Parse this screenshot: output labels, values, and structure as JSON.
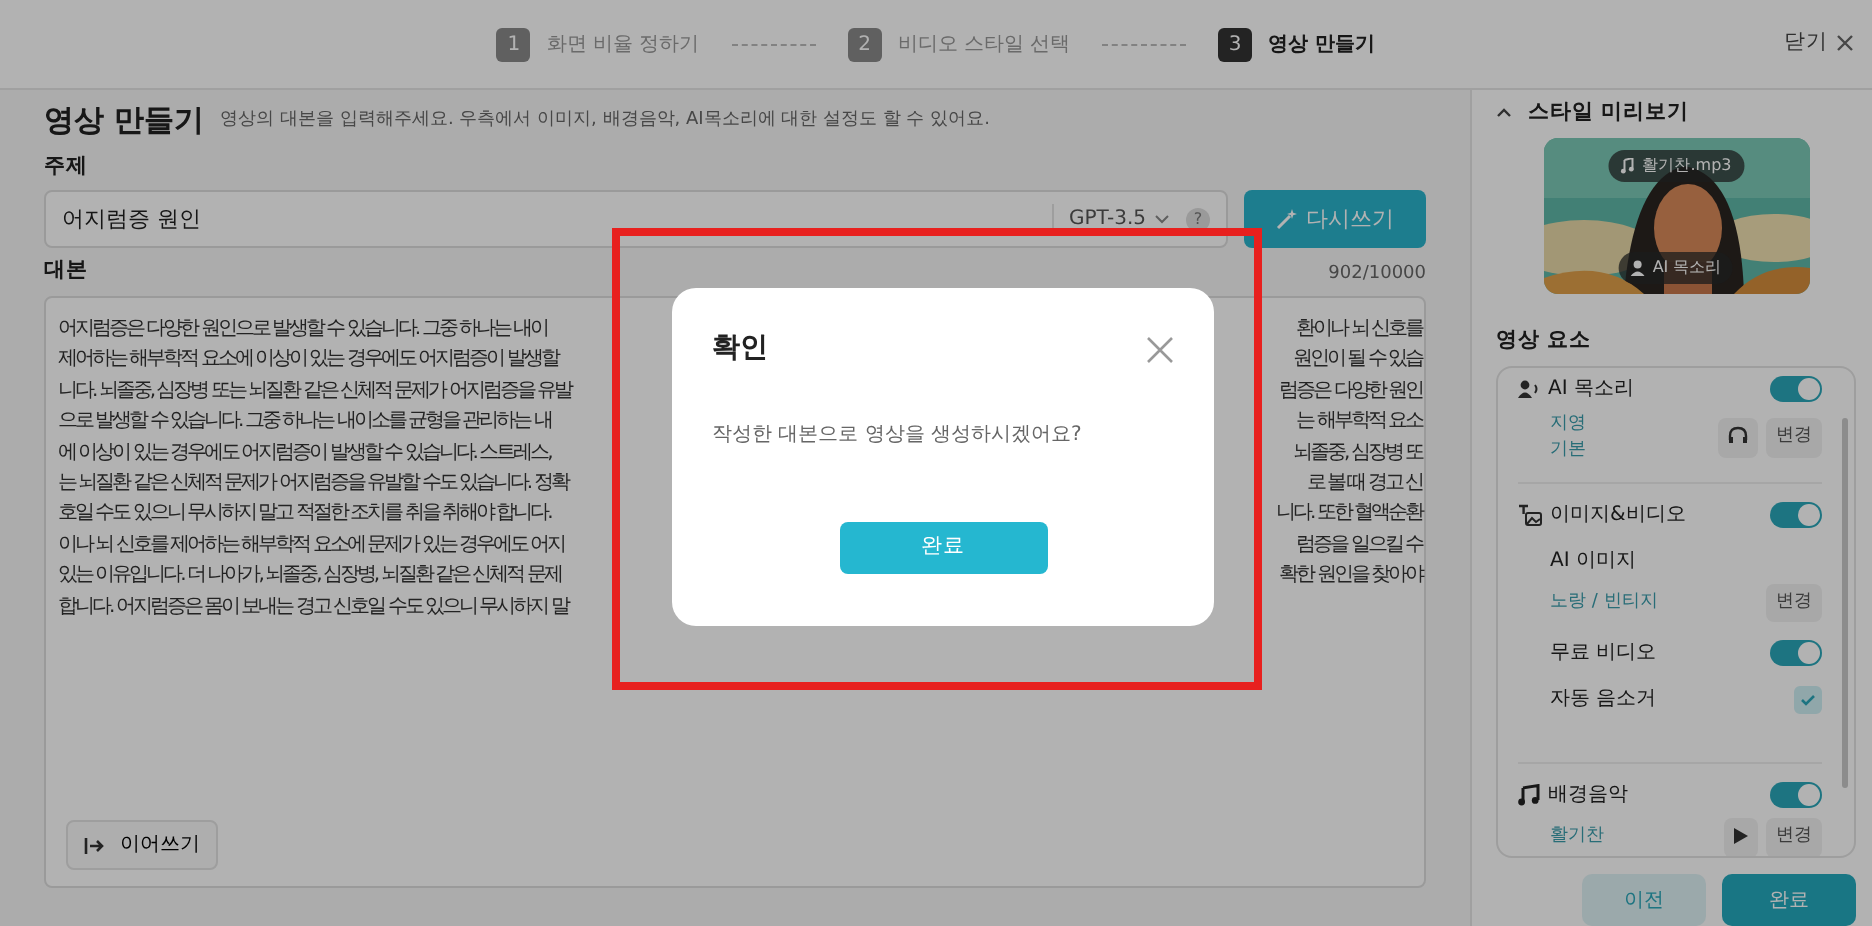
{
  "stepper": {
    "steps": [
      {
        "number": "1",
        "label": "화면 비율 정하기",
        "selected": false
      },
      {
        "number": "2",
        "label": "비디오 스타일 선택",
        "selected": false
      },
      {
        "number": "3",
        "label": "영상 만들기",
        "selected": true
      }
    ],
    "close": "닫기"
  },
  "editor": {
    "title": "영상 만들기",
    "description": "영상의 대본을 입력해주세요. 우측에서 이미지, 배경음악, AI목소리에 대한 설정도 할 수 있어요.",
    "topic": {
      "label": "주제",
      "value": "어지럼증 원인",
      "model": "GPT-3.5",
      "help": "?"
    },
    "rewrite_button": "다시쓰기",
    "script": {
      "label": "대본",
      "counter": "902/10000",
      "lines": [
        {
          "left": "어지럼증은 다양한 원인으로 발생할 수 있습니다. 그중 하나는 내이",
          "right": "환이나 뇌 신호를"
        },
        {
          "left": "제어하는 해부학적 요소에 이상이 있는 경우에도 어지럼증이 발생할",
          "right": "원인이 될 수 있습"
        },
        {
          "left": "니다. 뇌졸중, 심장병 또는 뇌질환 같은 신체적 문제가 어지럼증을 유발",
          "right": "럼증은 다양한 원인"
        },
        {
          "left": "으로 발생할 수 있습니다. 그중 하나는 내이소를 균형을 관리하는 내",
          "right": "는 해부학적 요소"
        },
        {
          "left": "에 이상이 있는 경우에도 어지럼증이 발생할 수 있습니다. 스트레스,",
          "right": "뇌졸중, 심장병 또"
        },
        {
          "left": "는 뇌질환 같은 신체적 문제가 어지럼증을 유발할 수도 있습니다. 정확",
          "right": "로 볼 때 경고 신"
        },
        {
          "left": "호일 수도 있으니 무시하지 말고 적절한 조치를 취을 취해야 합니다.",
          "right": "니다. 또한 혈액순환"
        },
        {
          "left": "이나 뇌 신호를 제어하는 해부학적 요소에 문제가 있는 경우에도 어지",
          "right": "럼증을 일으킬 수"
        },
        {
          "left": "있는 이유입니다. 더 나아가, 뇌졸중, 심장병, 뇌질환 같은 신체적 문제",
          "right": "확한 원인을 찾아야"
        },
        {
          "left": "합니다. 어지럼증은 몸이 보내는 경고 신호일 수도 있으니 무시하지 말"
        }
      ],
      "continue_button": "이어쓰기"
    }
  },
  "sidebar": {
    "preview": {
      "title": "스타일 미리보기",
      "expanded": true,
      "music_chip": "활기찬.mp3",
      "voice_chip": "AI 목소리"
    },
    "elements": {
      "title": "영상 요소",
      "sections": [
        {
          "kind": "voice",
          "title": "AI 목소리",
          "on": true,
          "values": [
            "지영",
            "기본"
          ],
          "action": "변경"
        },
        {
          "kind": "media",
          "title": "이미지&비디오",
          "on": true,
          "rows": [
            {
              "kind": "setting",
              "label": "AI 이미지",
              "value": "노랑 / 빈티지",
              "action": "변경"
            },
            {
              "kind": "toggle",
              "label": "무료 비디오",
              "on": true
            },
            {
              "kind": "checkbox",
              "label": "자동 음소거",
              "checked": true
            }
          ]
        },
        {
          "kind": "music",
          "title": "배경음악",
          "on": true,
          "track": "활기찬",
          "action": "변경"
        }
      ]
    },
    "prev_button": "이전",
    "done_button": "완료"
  },
  "dialog": {
    "title": "확인",
    "message": "작성한 대본으로 영상을 생성하시겠어요?",
    "confirm_button": "완료"
  },
  "annotation_frame": true
}
